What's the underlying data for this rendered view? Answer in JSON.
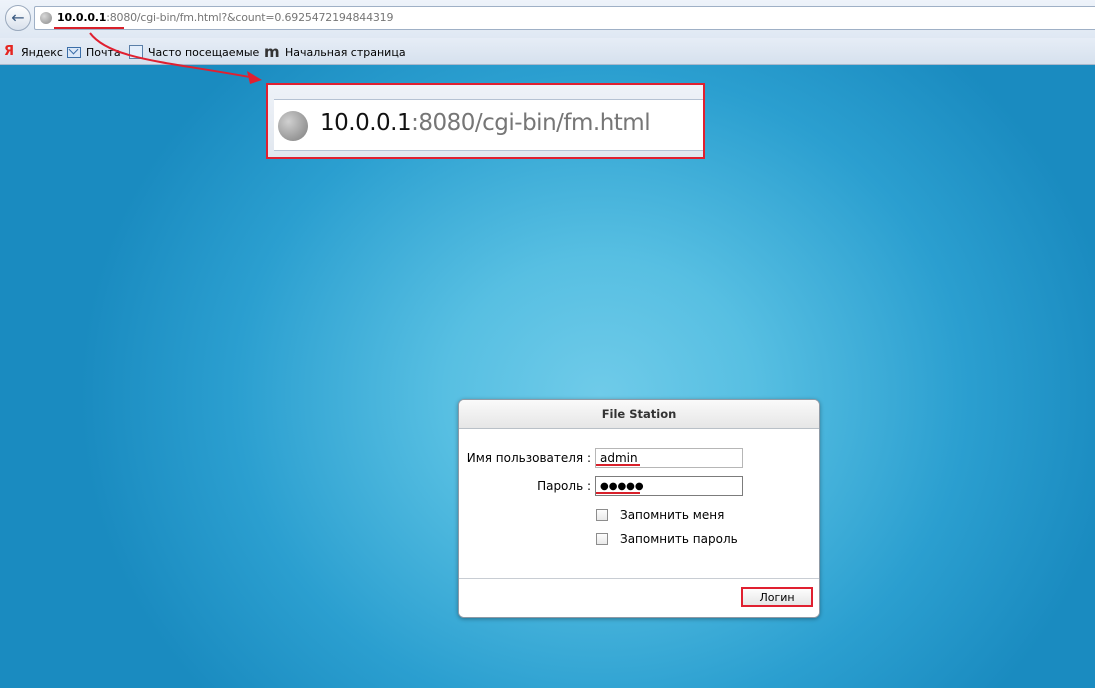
{
  "browser": {
    "url_host": "10.0.0.1",
    "url_rest": ":8080/cgi-bin/fm.html?&count=0.6925472194844319",
    "bookmarks": [
      {
        "label": "Яндекс",
        "icon": "yandex-icon"
      },
      {
        "label": "Почта",
        "icon": "mail-icon"
      },
      {
        "label": "Часто посещаемые",
        "icon": "frequent-icon"
      },
      {
        "label": "Начальная страница",
        "icon": "home-page-icon"
      }
    ]
  },
  "callout": {
    "url_host": "10.0.0.1",
    "url_rest": ":8080/cgi-bin/fm.html"
  },
  "dialog": {
    "title": "File Station",
    "username_label": "Имя пользователя :",
    "username_value": "admin",
    "password_label": "Пароль :",
    "password_value": "●●●●●",
    "remember_me": "Запомнить меня",
    "remember_password": "Запомнить пароль",
    "login_button": "Логин"
  },
  "colors": {
    "highlight_red": "#e02030",
    "page_blue": "#1e8fc4"
  }
}
